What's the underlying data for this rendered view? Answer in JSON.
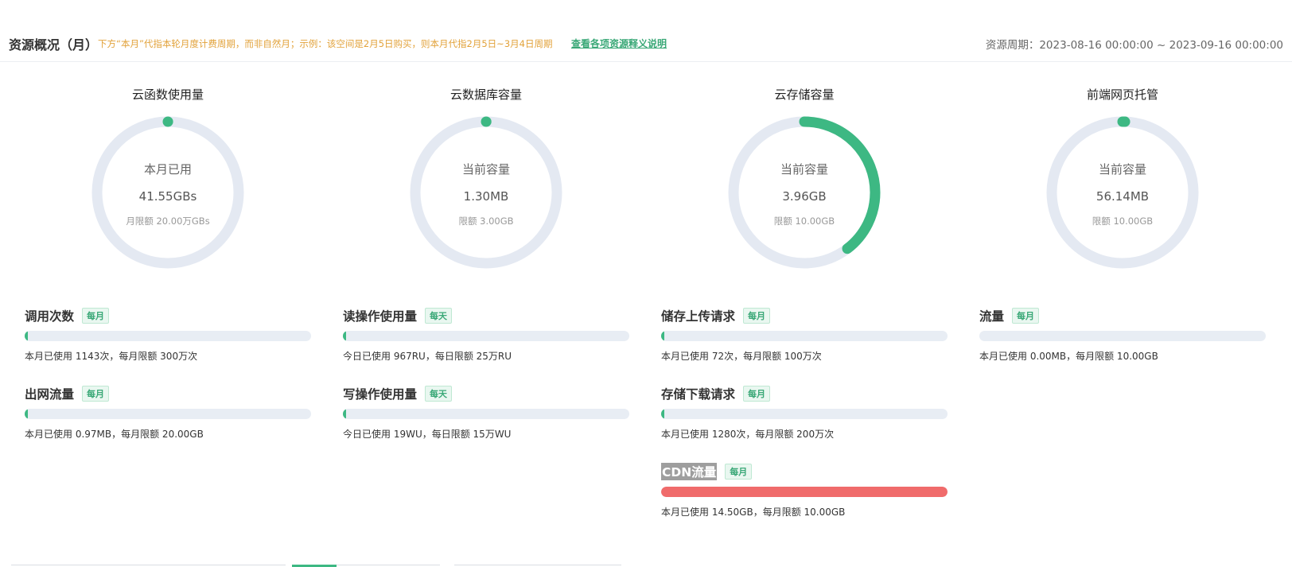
{
  "header": {
    "title": "资源概况（月）",
    "notice": "下方“本月”代指本轮月度计费周期，而非自然月；示例：该空间是2月5日购买，则本月代指2月5日~3月4日周期",
    "explain_link": "查看各项资源释义说明",
    "period_label": "资源周期：",
    "period_value": "2023-08-16 00:00:00 ~ 2023-09-16 00:00:00"
  },
  "colors": {
    "accent": "#3db883",
    "track": "#e4e9f2",
    "danger": "#f06b6b",
    "warning": "#e2a23a"
  },
  "gauges": [
    {
      "title": "云函数使用量",
      "label": "本月已用",
      "value": "41.55GBs",
      "limit": "月限额 20.00万GBs",
      "ratio": 0.0002
    },
    {
      "title": "云数据库容量",
      "label": "当前容量",
      "value": "1.30MB",
      "limit": "限额 3.00GB",
      "ratio": 0.0004
    },
    {
      "title": "云存储容量",
      "label": "当前容量",
      "value": "3.96GB",
      "limit": "限额 10.00GB",
      "ratio": 0.396
    },
    {
      "title": "前端网页托管",
      "label": "当前容量",
      "value": "56.14MB",
      "limit": "限额 10.00GB",
      "ratio": 0.0055
    }
  ],
  "metrics": [
    {
      "name": "调用次数",
      "badge": "每月",
      "text": "本月已使用 1143次，每月限额 300万次",
      "ratio": 0.0004,
      "color": "#3db883"
    },
    {
      "name": "出网流量",
      "badge": "每月",
      "text": "本月已使用 0.97MB，每月限额 20.00GB",
      "ratio": 0.0001,
      "color": "#3db883"
    },
    {
      "name": "读操作使用量",
      "badge": "每天",
      "text": "今日已使用 967RU，每日限额 25万RU",
      "ratio": 0.0039,
      "color": "#3db883"
    },
    {
      "name": "写操作使用量",
      "badge": "每天",
      "text": "今日已使用 19WU，每日限额 15万WU",
      "ratio": 0.0001,
      "color": "#3db883"
    },
    {
      "name": "储存上传请求",
      "badge": "每月",
      "text": "本月已使用 72次，每月限额 100万次",
      "ratio": 0.0001,
      "color": "#3db883"
    },
    {
      "name": "存储下载请求",
      "badge": "每月",
      "text": "本月已使用 1280次，每月限额 200万次",
      "ratio": 0.0006,
      "color": "#3db883"
    },
    {
      "name": "CDN流量",
      "badge": "每月",
      "text": "本月已使用 14.50GB，每月限额 10.00GB",
      "ratio": 1.0,
      "color": "#f06b6b"
    },
    {
      "name": "流量",
      "badge": "每月",
      "text": "本月已使用 0.00MB，每月限额 10.00GB",
      "ratio": 0.0,
      "color": "#3db883"
    }
  ]
}
